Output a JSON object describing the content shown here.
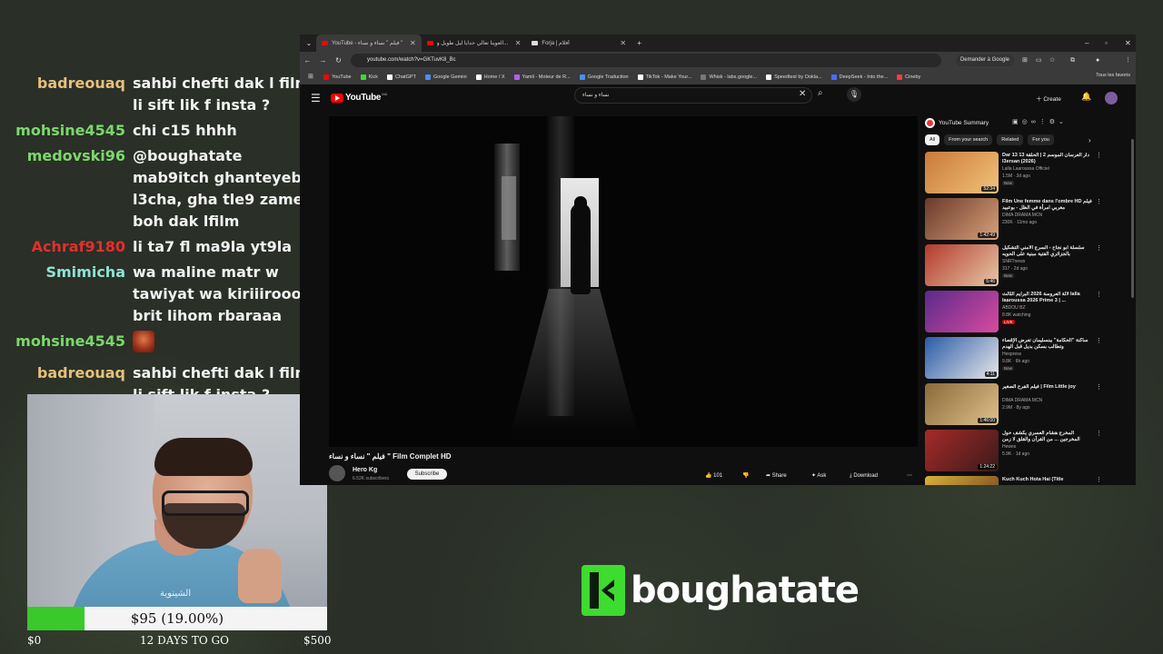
{
  "chat": {
    "messages": [
      {
        "user": "badreouaq",
        "color": "#e6c07a",
        "text": "sahbi chefti dak l film li sift lik f insta ?"
      },
      {
        "user": "mohsine4545",
        "color": "#7bd86b",
        "text": "chi c15 hhhh"
      },
      {
        "user": "medovski96",
        "color": "#7bd86b",
        "text": "@boughatate mab9itch ghanteyeb l3cha, gha tle9 zamel boh dak lfilm"
      },
      {
        "user": "Achraf9180",
        "color": "#e0312b",
        "text": "li ta7 fl ma9la yt9la"
      },
      {
        "user": "Smimicha",
        "color": "#8ee3d2",
        "text": "wa maline matr w tawiyat wa kiriiiroooo brit lihom rbaraaa"
      },
      {
        "user": "mohsine4545",
        "color": "#7bd86b",
        "text": "",
        "emote": "emote"
      },
      {
        "user": "badreouaq",
        "color": "#e6c07a",
        "text": "sahbi chefti dak l film li sift lik f insta ?"
      }
    ]
  },
  "webcam": {
    "watermark": "الشينوية"
  },
  "goal": {
    "label": "$95 (19.00%)",
    "progress": 0.19,
    "min": "$0",
    "days": "12 DAYS TO GO",
    "max": "$500",
    "fill_color": "#39c92b"
  },
  "browser": {
    "tabs": [
      {
        "label": "YouTube - فيلم \" نساء و نساء \"",
        "fav_color": "#ff0000",
        "active": true
      },
      {
        "label": "العوينا تعالي حدايا ليل طويل و...",
        "fav_color": "#ff0000",
        "active": false
      },
      {
        "label": "Forja | أفلام",
        "fav_color": "#dddddd",
        "active": false
      }
    ],
    "new_tab": "+",
    "url": "youtube.com/watch?v=GKTuvK8_Bc",
    "ask_google": "Demander à Google",
    "bookmarks": [
      {
        "label": "YouTube",
        "color": "#ff0000"
      },
      {
        "label": "Kick",
        "color": "#3ddc2f"
      },
      {
        "label": "ChatGPT",
        "color": "#ffffff"
      },
      {
        "label": "Google Gemini",
        "color": "#4a8cff"
      },
      {
        "label": "Home / X",
        "color": "#ffffff"
      },
      {
        "label": "Yamli - Moteur de R...",
        "color": "#b05cff"
      },
      {
        "label": "Google Traduction",
        "color": "#4a8cff"
      },
      {
        "label": "TikTok - Make Your...",
        "color": "#ffffff"
      },
      {
        "label": "Whisk - labs.google...",
        "color": "#777777"
      },
      {
        "label": "Speedtest by Ookla...",
        "color": "#ffffff"
      },
      {
        "label": "DeepSeek - Into the...",
        "color": "#4a6cff"
      },
      {
        "label": "Cineby",
        "color": "#ff3b3b"
      }
    ],
    "all_bookmarks": "Tous les favoris"
  },
  "youtube": {
    "wordmark": "YouTube",
    "region": "MA",
    "search_value": "نساء و نساء",
    "create": "Create",
    "video_title": "فيلم \" نساء و نساء \" Film Complet HD",
    "channel": {
      "name": "Hero Kg",
      "subs": "6.52K subscribers"
    },
    "subscribe": "Subscribe",
    "actions": {
      "likes": "101",
      "share": "Share",
      "ask": "Ask",
      "download": "Download"
    },
    "summary_title": "YouTube Summary",
    "chips": [
      "All",
      "From your search",
      "Related",
      "For you"
    ],
    "recommendations": [
      {
        "title": "Dar 13 دار العرسان الموسم 2 | الحلقة 13 l3ersan (2026)",
        "channel": "Lalla Laaroussa Officiel",
        "meta": "1.5M · 3d ago",
        "badge": "New",
        "duration": "52:34",
        "thumb": [
          "#c97a3a",
          "#f2c27a"
        ]
      },
      {
        "title": "Film Une femme dans l'ombre HD فيلم مغربي امرأة في الظل - بوعبيد",
        "channel": "DIMA DRAMA MCN",
        "meta": "230K · 11mo ago",
        "badge": "",
        "duration": "1:42:49",
        "thumb": [
          "#6a3a2a",
          "#d9a07a"
        ]
      },
      {
        "title": "سلسلة أبو نجاح - السرج الأمني التشكيل بالجزائري الفتية مبنية على الحويه",
        "channel": "SNRTnews",
        "meta": "317 · 2d ago",
        "badge": "New",
        "duration": "5:46",
        "thumb": [
          "#b23a2a",
          "#e8c8a8"
        ]
      },
      {
        "title": "لالة العروسة 2026 البرايم الثالث lalla laaroussa 2026 Prime 3 | ...",
        "channel": "ABDOU BZ",
        "meta": "8.8K watching",
        "badge": "LIVE",
        "duration": "",
        "thumb": [
          "#5a2a8a",
          "#d94aa0"
        ]
      },
      {
        "title": "ساكنة \"الحكامة\" ببنسليمان تعرض الإقصاء وتطالب بسكن بديل قبل الهدم",
        "channel": "Hespress",
        "meta": "9.8K · 6h ago",
        "badge": "New",
        "duration": "4:11",
        "thumb": [
          "#2a5aa8",
          "#e8e8e8"
        ]
      },
      {
        "title": "فيلم الفرح الصغير | Film Little joy",
        "channel": "DIMA DRAMA MCN",
        "meta": "2.9M · 8y ago",
        "badge": "",
        "duration": "1:46:00",
        "thumb": [
          "#8a6a3a",
          "#e0c08a"
        ]
      },
      {
        "title": "المخرج هشام العسري يكشف حول المخرجين ... من القرآن والقلق لا زمن",
        "channel": "Hewes",
        "meta": "5.9K · 1d ago",
        "badge": "",
        "duration": "1:24:22",
        "thumb": [
          "#a82a2a",
          "#3a1a1a"
        ]
      },
      {
        "title": "Kuch Kuch Hota Hai (Title",
        "channel": "",
        "meta": "",
        "badge": "",
        "duration": "",
        "thumb": [
          "#d9b03a",
          "#6a3a1a"
        ]
      }
    ]
  },
  "brand": {
    "name": "boughatate"
  }
}
